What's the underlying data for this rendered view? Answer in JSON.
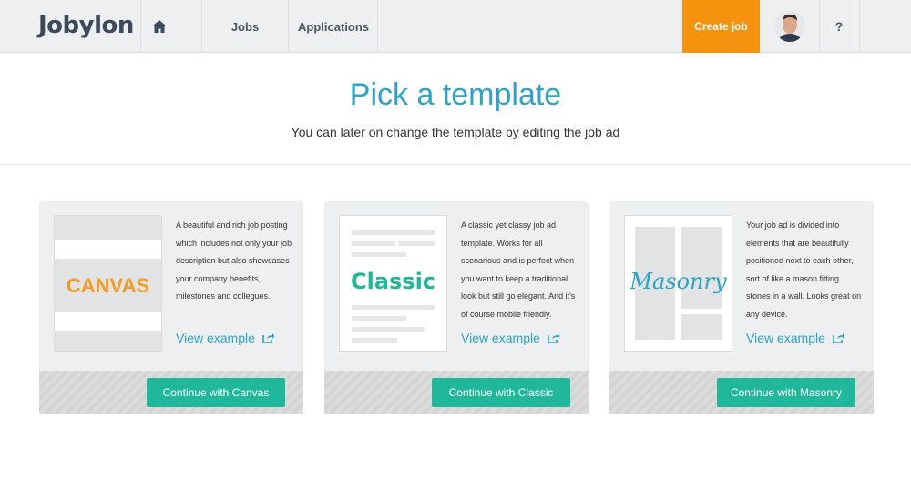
{
  "colors": {
    "accent_orange": "#f5930f",
    "teal": "#1fb89a",
    "link_blue": "#29a5c9",
    "heading_blue": "#2ea3c8",
    "logo_navy": "#3d4a5c"
  },
  "nav": {
    "logo": "Jobylon",
    "home_icon": "home-icon",
    "jobs_label": "Jobs",
    "applications_label": "Applications",
    "create_job_label": "Create job",
    "help_label": "?"
  },
  "hero": {
    "title": "Pick a template",
    "subtitle": "You can later on change the template by editing the job ad"
  },
  "templates": [
    {
      "thumb_label": "CANVAS",
      "description": "A beautiful and rich job posting which includes not only your job description but also showcases your company benefits, milestones and collegues.",
      "view_label": "View example",
      "view_icon": "external-link-icon",
      "button_label": "Continue with Canvas"
    },
    {
      "thumb_label": "Classic",
      "description": "A classic yet classy job ad template. Works for all scenarious and is perfect when you want to keep a traditional look but still go elegant. And it's of course mobile friendly.",
      "view_label": "View example",
      "view_icon": "external-link-icon",
      "button_label": "Continue with Classic"
    },
    {
      "thumb_label": "Masonry",
      "description": "Your job ad is divided into elements that are beautifully positioned next to each other, sort of like a mason fitting stones in a wall. Looks great on any device.",
      "view_label": "View example",
      "view_icon": "external-link-icon",
      "button_label": "Continue with Masonry"
    }
  ]
}
